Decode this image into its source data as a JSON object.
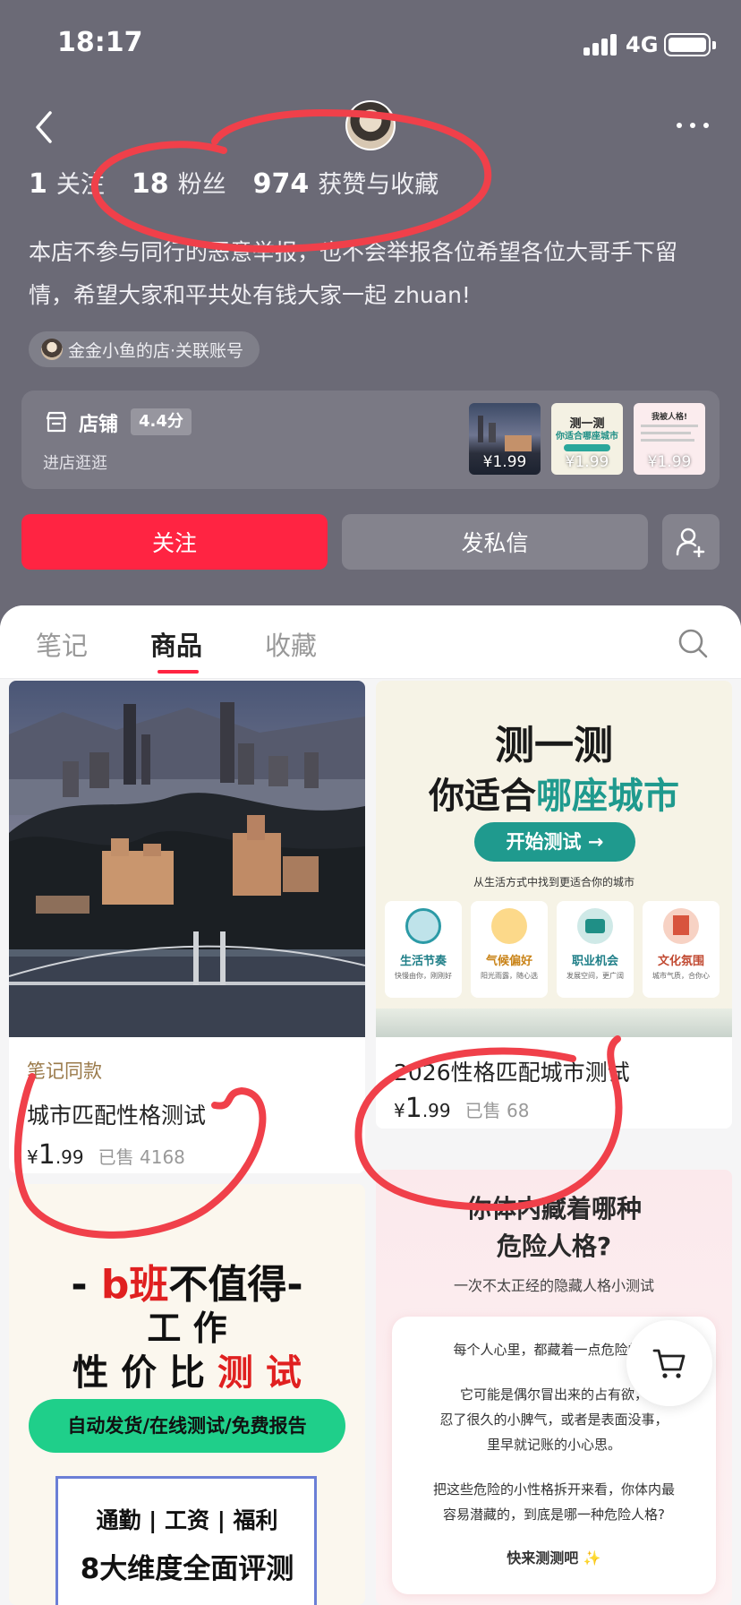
{
  "status_bar": {
    "time": "18:17",
    "network": "4G"
  },
  "profile": {
    "stats": [
      {
        "num": "1",
        "label": "关注"
      },
      {
        "num": "18",
        "label": "粉丝"
      },
      {
        "num": "974",
        "label": "获赞与收藏"
      }
    ],
    "bio_line1": "本店不参与同行的恶意举报，也不会举报各位希望各位大哥手下留",
    "bio_line2": "情，希望大家和平共处有钱大家一起 zhuan!",
    "linked_account": "金金小鱼的店·关联账号"
  },
  "shop": {
    "label": "店铺",
    "rating": "4.4分",
    "subtitle": "进店逛逛",
    "thumbs": [
      {
        "price": "¥1.99"
      },
      {
        "price": "¥1.99",
        "title1": "测一测",
        "title2": "你适合哪座城市"
      },
      {
        "price": "¥1.99",
        "title1": "我被人格!"
      }
    ]
  },
  "actions": {
    "follow": "关注",
    "message": "发私信"
  },
  "tabs": [
    "笔记",
    "商品",
    "收藏"
  ],
  "products": [
    {
      "tag": "笔记同款",
      "title": "城市匹配性格测试",
      "price_yen": "¥",
      "price_int": "1",
      "price_dec": ".99",
      "sold": "已售 4168"
    },
    {
      "title": "2026性格匹配城市测试",
      "price_yen": "¥",
      "price_int": "1",
      "price_dec": ".99",
      "sold": "已售 68"
    }
  ],
  "poster_city": {
    "title1": "测一测",
    "title2a": "你适合",
    "title2b": "哪座城市",
    "start": "开始测试 →",
    "sub": "从生活方式中找到更适合你的城市",
    "features": [
      {
        "name": "生活节奏",
        "desc": "快慢由你，刚刚好"
      },
      {
        "name": "气候偏好",
        "desc": "阳光雨露，随心选"
      },
      {
        "name": "职业机会",
        "desc": "发展空间，更广阔"
      },
      {
        "name": "文化氛围",
        "desc": "城市气质，合你心"
      }
    ]
  },
  "poster_work": {
    "line1a": "- ",
    "line1b": "b班",
    "line1c": "不值得-",
    "line2": "工 作",
    "line3a": "性 价 比 ",
    "line3b": "测 试",
    "pill": "自动发货/在线测试/免费报告",
    "dims": "通勤 | 工资 | 福利",
    "eval": "8大维度全面评测"
  },
  "poster_danger": {
    "title1": "你体内藏着哪种",
    "title2": "危险人格?",
    "sub": "一次不太正经的隐藏人格小测试",
    "p1": "每个人心里，都藏着一点危险的小",
    "p2a": "它可能是偶尔冒出来的占有欲，",
    "p2b": "忍了很久的小脾气，或者是表面没事，",
    "p2c": "里早就记账的小心思。",
    "p3a": "把这些危险的小性格拆开来看，你体内最",
    "p3b": "容易潜藏的，到底是哪一种危险人格?",
    "cta": "快来测测吧 ✨"
  },
  "colors": {
    "brand_red": "#ff2442",
    "header_bg": "#6b6a76",
    "annotation": "#f0404a"
  }
}
